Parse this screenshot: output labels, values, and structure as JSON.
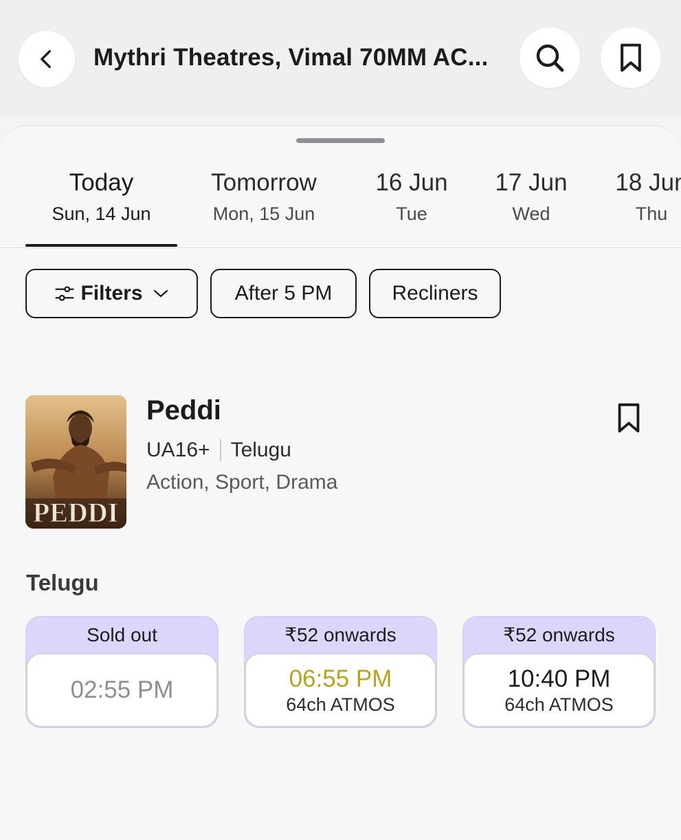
{
  "header": {
    "title": "Mythri Theatres, Vimal 70MM AC...",
    "back_icon": "chevron-left-icon",
    "search_icon": "search-icon",
    "bookmark_icon": "bookmark-icon"
  },
  "date_tabs": [
    {
      "day": "Today",
      "date": "Sun, 14 Jun",
      "active": true
    },
    {
      "day": "Tomorrow",
      "date": "Mon, 15 Jun",
      "active": false
    },
    {
      "day": "16 Jun",
      "date": "Tue",
      "active": false
    },
    {
      "day": "17 Jun",
      "date": "Wed",
      "active": false
    },
    {
      "day": "18 Jun",
      "date": "Thu",
      "active": false
    }
  ],
  "filters": {
    "filters_label": "Filters",
    "after5_label": "After 5 PM",
    "recliners_label": "Recliners"
  },
  "movie": {
    "title": "Peddi",
    "certificate": "UA16+",
    "language": "Telugu",
    "genres": "Action, Sport, Drama",
    "poster_text": "PEDDI"
  },
  "showtimes": {
    "language_heading": "Telugu",
    "shows": [
      {
        "price_label": "Sold out",
        "time": "02:55 PM",
        "format": ""
      },
      {
        "price_label": "₹52 onwards",
        "time": "06:55 PM",
        "format": "64ch ATMOS"
      },
      {
        "price_label": "₹52 onwards",
        "time": "10:40 PM",
        "format": "64ch ATMOS"
      }
    ]
  },
  "colors": {
    "accent_purple": "#ddd6fb",
    "filling_fast": "#b7a41d",
    "sold_out_text": "#8e8e93"
  }
}
